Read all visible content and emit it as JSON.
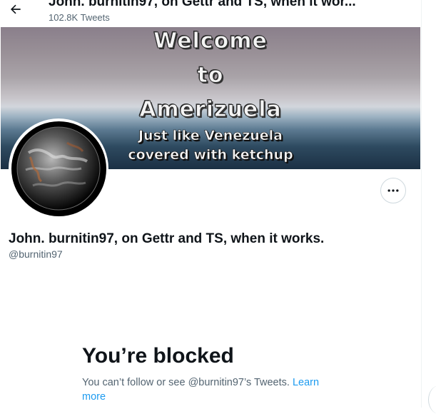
{
  "header": {
    "back_icon": "arrow-left-icon",
    "display_name": "John. burnitin97, on Gettr and TS, when it wor...",
    "tweet_count": "102.8K Tweets"
  },
  "banner": {
    "line1": "Welcome",
    "line2": "to",
    "line3": "Amerizuela",
    "line4": "Just like Venezuela",
    "line5": "covered with ketchup"
  },
  "profile": {
    "avatar_icon": "earth-globe-icon",
    "more_icon": "more-horizontal-icon",
    "name": "John. burnitin97, on Gettr and TS, when it works.",
    "handle": "@burnitin97"
  },
  "blocked": {
    "title": "You’re blocked",
    "message": "You can’t follow or see @burnitin97’s Tweets.",
    "learn_more": "Learn more"
  },
  "colors": {
    "text_primary": "#0f1419",
    "text_secondary": "#536471",
    "link": "#1d9bf0",
    "border": "#cfd9de"
  }
}
